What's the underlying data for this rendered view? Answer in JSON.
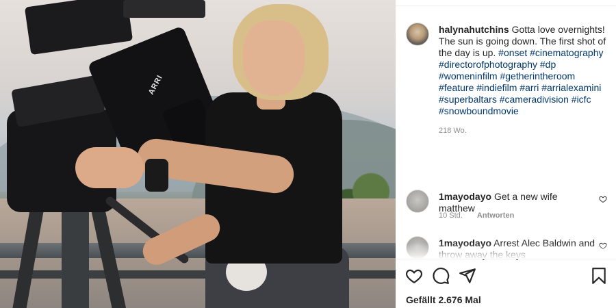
{
  "post": {
    "username": "halynahutchins",
    "caption_text": "Gotta love overnights! The sun is going down. The first shot of the day is up.",
    "hashtags": [
      "#onset",
      "#cinematography",
      "#directorofphotography",
      "#dp",
      "#womeninfilm",
      "#getherintheroom",
      "#feature",
      "#indiefilm",
      "#arri",
      "#arrialexamini",
      "#superbaltars",
      "#cameradivision",
      "#icfc",
      "#snowboundmovie"
    ],
    "time": "218 Wo.",
    "photo_camera_label": "ARRI"
  },
  "comments": [
    {
      "username": "1mayodayo",
      "text": "Get a new wife matthew",
      "time": "10 Std.",
      "reply_label": "Antworten"
    },
    {
      "username": "1mayodayo",
      "text": "Arrest Alec Baldwin and throw away the keys"
    }
  ],
  "actions": {
    "like": "heart-icon",
    "comment": "comment-bubble-icon",
    "share": "paper-plane-icon",
    "save": "bookmark-icon"
  },
  "likes_text": "Gefällt 2.676 Mal"
}
